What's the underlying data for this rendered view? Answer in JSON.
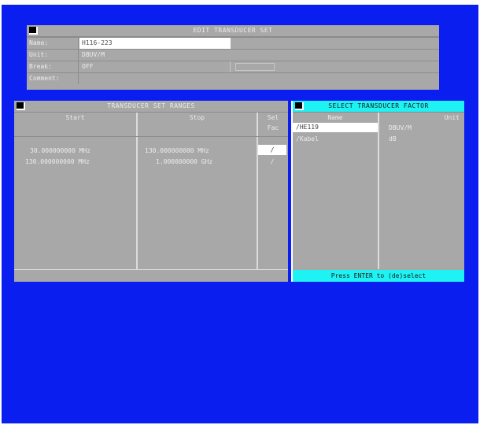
{
  "edit_set": {
    "title": "EDIT TRANSDUCER SET",
    "name_label": "Name:",
    "name_value": "H116-223",
    "unit_label": "Unit:",
    "unit_value": "DBUV/M",
    "break_label": "Break:",
    "break_value": "OFF",
    "comment_label": "Comment:",
    "comment_value": ""
  },
  "ranges": {
    "title": "TRANSDUCER SET RANGES",
    "col_start": "Start",
    "col_stop": "Stop",
    "col_sel": "Sel",
    "col_fac": "Fac",
    "rows": [
      {
        "start": "30.000000000 MHz",
        "stop": "130.000000000 MHz",
        "sel": "/"
      },
      {
        "start": "130.000000000 MHz",
        "stop": "1.000000000 GHz",
        "sel": "/"
      }
    ]
  },
  "factor": {
    "title": "SELECT TRANSDUCER FACTOR",
    "col_name": "Name",
    "col_unit": "Unit",
    "items": [
      {
        "name": "/HE119",
        "unit": "DBUV/M",
        "selected": true
      },
      {
        "name": "/Kabel",
        "unit": "dB",
        "selected": false
      }
    ],
    "footer": "Press ENTER to (de)select"
  },
  "colors": {
    "background": "#0a1ef0",
    "panel": "#a8a8a8",
    "highlight": "#1ef2f2"
  }
}
